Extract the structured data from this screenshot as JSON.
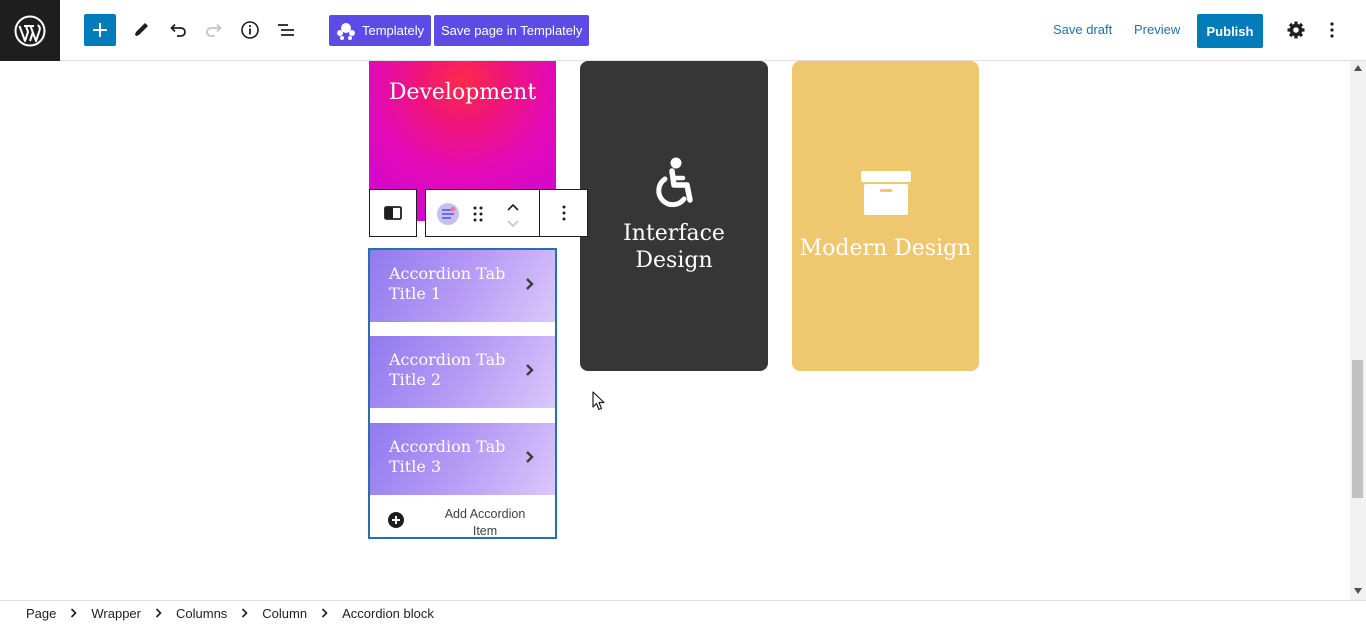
{
  "toolbar": {
    "templately_label": "Templately",
    "save_templately_label": "Save page in Templately",
    "save_draft_label": "Save draft",
    "preview_label": "Preview",
    "publish_label": "Publish"
  },
  "cards": {
    "development_title": "Development",
    "interface_title_line1": "Interface",
    "interface_title_line2": "Design",
    "modern_title": "Modern Design"
  },
  "accordion": {
    "items": [
      {
        "line1": "Accordion Tab",
        "line2": "Title 1"
      },
      {
        "line1": "Accordion Tab",
        "line2": "Title 2"
      },
      {
        "line1": "Accordion Tab",
        "line2": "Title 3"
      }
    ],
    "add_label_line1": "Add Accordion",
    "add_label_line2": "Item"
  },
  "breadcrumb": [
    "Page",
    "Wrapper",
    "Columns",
    "Column",
    "Accordion block"
  ],
  "colors": {
    "wp_dark": "#1e1e1e",
    "primary_blue": "#007cba",
    "templately_purple": "#5c4ce5",
    "interface_card": "#363636",
    "modern_card": "#efc76f"
  }
}
